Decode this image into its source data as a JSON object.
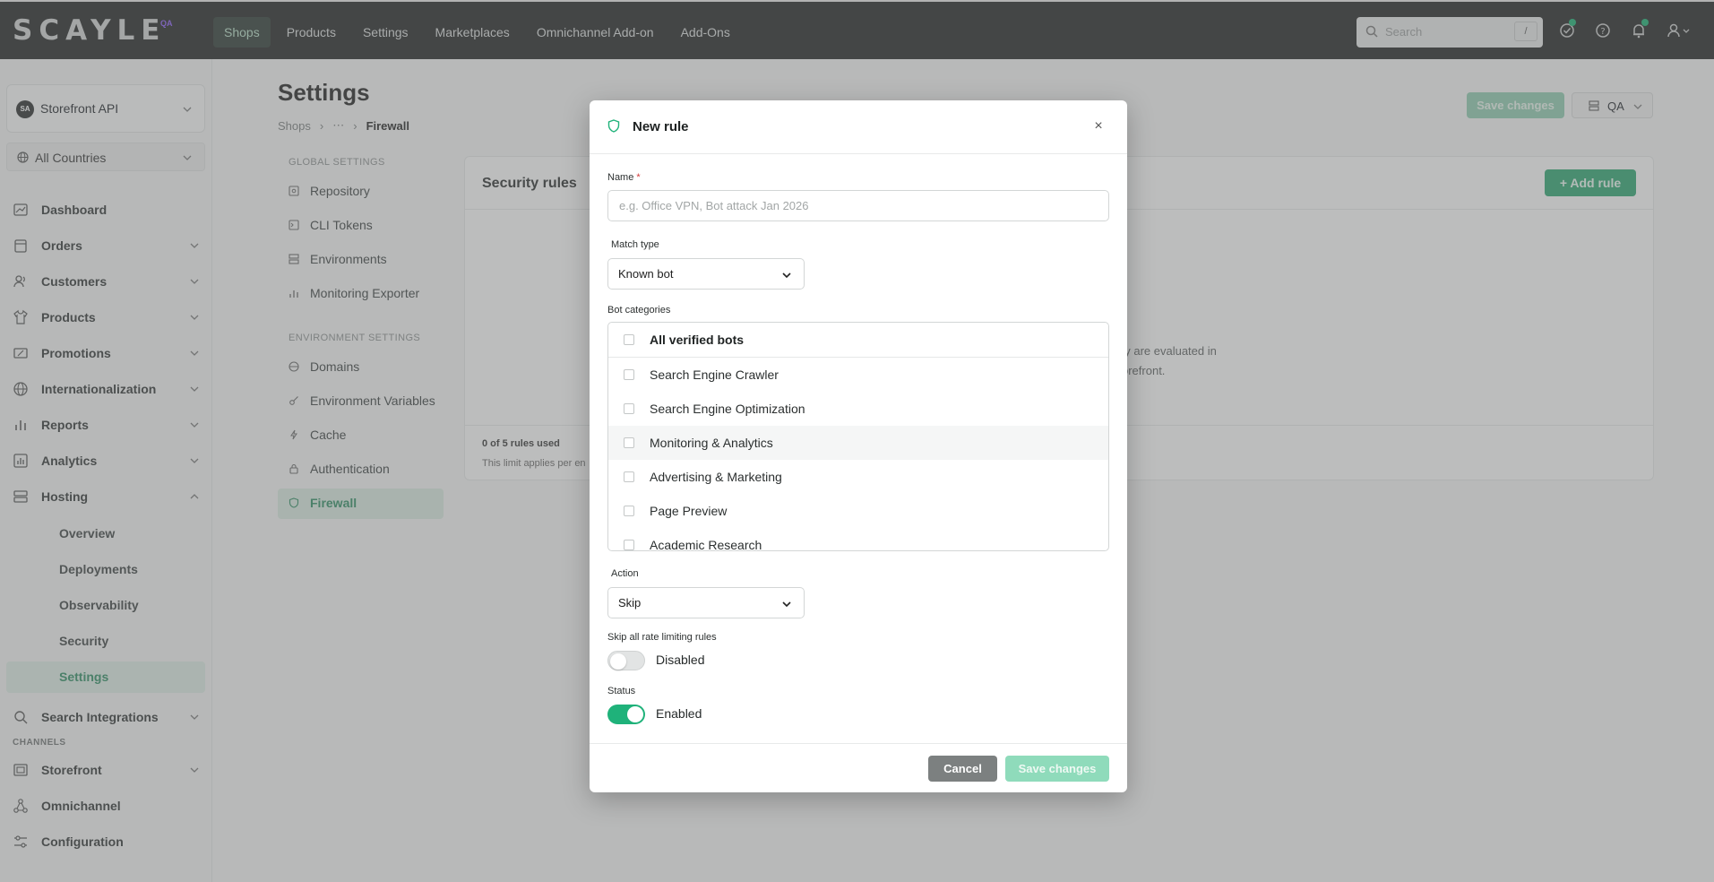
{
  "topbar": {
    "logo": "SCAYLE",
    "logo_badge": "QA",
    "nav": [
      "Shops",
      "Products",
      "Settings",
      "Marketplaces",
      "Omnichannel Add-on",
      "Add-Ons"
    ],
    "search_placeholder": "Search",
    "search_shortcut": "/"
  },
  "sidebar": {
    "shop_initials": "SA",
    "shop_name": "Storefront API",
    "country": "All Countries",
    "items": [
      {
        "label": "Dashboard"
      },
      {
        "label": "Orders"
      },
      {
        "label": "Customers"
      },
      {
        "label": "Products"
      },
      {
        "label": "Promotions"
      },
      {
        "label": "Internationalization"
      },
      {
        "label": "Reports"
      },
      {
        "label": "Analytics"
      },
      {
        "label": "Hosting"
      }
    ],
    "hosting_sub": [
      "Overview",
      "Deployments",
      "Observability",
      "Security",
      "Settings"
    ],
    "search_integrations": "Search Integrations",
    "channels_heading": "CHANNELS",
    "channels": [
      "Storefront",
      "Omnichannel",
      "Configuration"
    ]
  },
  "page": {
    "title": "Settings",
    "breadcrumb": {
      "root": "Shops",
      "ellipsis": "⋯",
      "current": "Firewall"
    },
    "save_changes": "Save changes",
    "environment": "QA"
  },
  "settings_nav": {
    "global_heading": "GLOBAL SETTINGS",
    "global_items": [
      "Repository",
      "CLI Tokens",
      "Environments",
      "Monitoring Exporter"
    ],
    "env_heading": "ENVIRONMENT SETTINGS",
    "env_items": [
      "Domains",
      "Environment Variables",
      "Cache",
      "Authentication",
      "Firewall"
    ]
  },
  "card": {
    "title": "Security rules",
    "add_rule": "+   Add rule",
    "text_line1": "ey are evaluated in",
    "text_line2": "orefront.",
    "rules_used": "0 of 5 rules used",
    "rules_limit": "This limit applies per en"
  },
  "modal": {
    "title": "New rule",
    "close": "×",
    "name_label": "Name",
    "name_required": "*",
    "name_placeholder": "e.g. Office VPN, Bot attack Jan 2026",
    "match_type_label": "Match type",
    "match_type_value": "Known bot",
    "bot_categories_label": "Bot categories",
    "bot_categories": [
      {
        "label": "All verified bots",
        "checked": false
      },
      {
        "label": "Search Engine Crawler",
        "checked": false
      },
      {
        "label": "Search Engine Optimization",
        "checked": false
      },
      {
        "label": "Monitoring & Analytics",
        "checked": false
      },
      {
        "label": "Advertising & Marketing",
        "checked": false
      },
      {
        "label": "Page Preview",
        "checked": false
      },
      {
        "label": "Academic Research",
        "checked": false
      }
    ],
    "action_label": "Action",
    "action_value": "Skip",
    "skip_rate_label": "Skip all rate limiting rules",
    "skip_rate_state": "Disabled",
    "status_label": "Status",
    "status_state": "Enabled",
    "cancel": "Cancel",
    "save": "Save changes"
  },
  "colors": {
    "accent": "#1fb27a",
    "topbar": "#222323",
    "save_disabled": "#8fdbbb"
  }
}
